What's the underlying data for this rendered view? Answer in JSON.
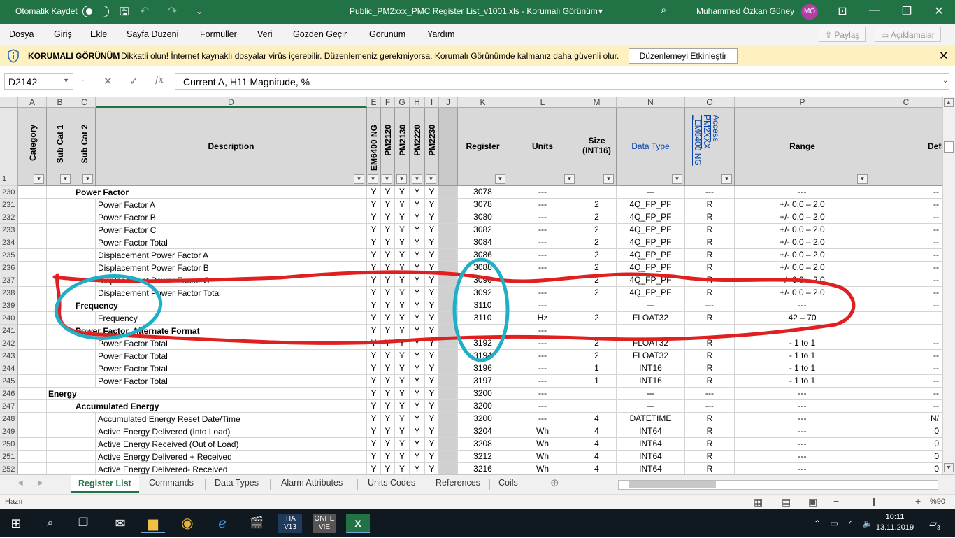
{
  "titlebar": {
    "autosave": "Otomatik Kaydet",
    "title": "Public_PM2xxx_PMC Register List_v1001.xls  -  Korumalı Görünüm",
    "title_caret": "▾",
    "user": "Muhammed Özkan Güney",
    "initials": "MÖ"
  },
  "menu": {
    "items": [
      "Dosya",
      "Giriş",
      "Ekle",
      "Sayfa Düzeni",
      "Formüller",
      "Veri",
      "Gözden Geçir",
      "Görünüm",
      "Yardım"
    ],
    "share": "Paylaş",
    "comments": "Açıklamalar"
  },
  "protected": {
    "title": "KORUMALI GÖRÜNÜM",
    "message": "Dikkatli olun! İnternet kaynaklı dosyalar virüs içerebilir. Düzenlemeniz gerekmiyorsa, Korumalı Görünümde kalmanız daha güvenli olur.",
    "button": "Düzenlemeyi Etkinleştir"
  },
  "formula": {
    "namebox": "D2142",
    "content": "Current A, H11 Magnitude, %",
    "fx": "fx"
  },
  "columns": [
    "A",
    "B",
    "C",
    "D",
    "E",
    "F",
    "G",
    "H",
    "I",
    "J",
    "K",
    "L",
    "M",
    "N",
    "O",
    "P",
    "Q"
  ],
  "headers": {
    "category": "Category",
    "subcat1": "Sub Cat 1",
    "subcat2": "Sub Cat 2",
    "description": "Description",
    "em6400": "EM6400 NG",
    "pm2120": "PM2120",
    "pm2130": "PM2130",
    "pm2220": "PM2220",
    "pm2230": "PM2230",
    "register": "Register",
    "units": "Units",
    "size": "Size (INT16)",
    "datatype": "Data Type",
    "access": "Access PM2XXX _EM6400 NG",
    "range": "Range",
    "default": "Defa",
    "rownum": "1"
  },
  "rows": [
    {
      "n": "230",
      "lvl": "c",
      "desc": "Power Factor",
      "flags": [
        "Y",
        "Y",
        "Y",
        "Y",
        "Y"
      ],
      "reg": "3078",
      "units": "---",
      "size": "",
      "dtype": "---",
      "access": "---",
      "range": "---",
      "def": "--"
    },
    {
      "n": "231",
      "lvl": "d",
      "desc": "Power Factor A",
      "flags": [
        "Y",
        "Y",
        "Y",
        "Y",
        "Y"
      ],
      "reg": "3078",
      "units": "---",
      "size": "2",
      "dtype": "4Q_FP_PF",
      "access": "R",
      "range": "+/- 0.0 – 2.0",
      "def": "--"
    },
    {
      "n": "232",
      "lvl": "d",
      "desc": "Power Factor B",
      "flags": [
        "Y",
        "Y",
        "Y",
        "Y",
        "Y"
      ],
      "reg": "3080",
      "units": "---",
      "size": "2",
      "dtype": "4Q_FP_PF",
      "access": "R",
      "range": "+/- 0.0 – 2.0",
      "def": "--"
    },
    {
      "n": "233",
      "lvl": "d",
      "desc": "Power Factor C",
      "flags": [
        "Y",
        "Y",
        "Y",
        "Y",
        "Y"
      ],
      "reg": "3082",
      "units": "---",
      "size": "2",
      "dtype": "4Q_FP_PF",
      "access": "R",
      "range": "+/- 0.0 – 2.0",
      "def": "--"
    },
    {
      "n": "234",
      "lvl": "d",
      "desc": "Power Factor Total",
      "flags": [
        "Y",
        "Y",
        "Y",
        "Y",
        "Y"
      ],
      "reg": "3084",
      "units": "---",
      "size": "2",
      "dtype": "4Q_FP_PF",
      "access": "R",
      "range": "+/- 0.0 – 2.0",
      "def": "--"
    },
    {
      "n": "235",
      "lvl": "d",
      "desc": "Displacement Power Factor A",
      "flags": [
        "Y",
        "Y",
        "Y",
        "Y",
        "Y"
      ],
      "reg": "3086",
      "units": "---",
      "size": "2",
      "dtype": "4Q_FP_PF",
      "access": "R",
      "range": "+/- 0.0 – 2.0",
      "def": "--"
    },
    {
      "n": "236",
      "lvl": "d",
      "desc": "Displacement Power Factor B",
      "flags": [
        "Y",
        "Y",
        "Y",
        "Y",
        "Y"
      ],
      "reg": "3088",
      "units": "---",
      "size": "2",
      "dtype": "4Q_FP_PF",
      "access": "R",
      "range": "+/- 0.0 – 2.0",
      "def": "--"
    },
    {
      "n": "237",
      "lvl": "d",
      "desc": "Displacement Power Factor C",
      "flags": [
        "Y",
        "Y",
        "Y",
        "Y",
        "Y"
      ],
      "reg": "3090",
      "units": "---",
      "size": "2",
      "dtype": "4Q_FP_PF",
      "access": "R",
      "range": "+/- 0.0 – 2.0",
      "def": "--"
    },
    {
      "n": "238",
      "lvl": "d",
      "desc": "Displacement Power Factor Total",
      "flags": [
        "Y",
        "Y",
        "Y",
        "Y",
        "Y"
      ],
      "reg": "3092",
      "units": "---",
      "size": "2",
      "dtype": "4Q_FP_PF",
      "access": "R",
      "range": "+/- 0.0 – 2.0",
      "def": "--"
    },
    {
      "n": "239",
      "lvl": "c",
      "desc": "Frequency",
      "flags": [
        "Y",
        "Y",
        "Y",
        "Y",
        "Y"
      ],
      "reg": "3110",
      "units": "---",
      "size": "",
      "dtype": "---",
      "access": "---",
      "range": "---",
      "def": "--"
    },
    {
      "n": "240",
      "lvl": "d",
      "desc": "Frequency",
      "flags": [
        "Y",
        "Y",
        "Y",
        "Y",
        "Y"
      ],
      "reg": "3110",
      "units": "Hz",
      "size": "2",
      "dtype": "FLOAT32",
      "access": "R",
      "range": "42 – 70",
      "def": ""
    },
    {
      "n": "241",
      "lvl": "c",
      "desc": "Power Factor, Alternate Format",
      "flags": [
        "Y",
        "Y",
        "Y",
        "Y",
        "Y"
      ],
      "reg": "",
      "units": "---",
      "size": "",
      "dtype": "",
      "access": "",
      "range": "",
      "def": ""
    },
    {
      "n": "242",
      "lvl": "d",
      "desc": "Power Factor Total",
      "flags": [
        "Y",
        "Y",
        "Y",
        "Y",
        "Y"
      ],
      "reg": "3192",
      "units": "---",
      "size": "2",
      "dtype": "FLOAT32",
      "access": "R",
      "range": "- 1 to 1",
      "def": "--"
    },
    {
      "n": "243",
      "lvl": "d",
      "desc": "Power Factor Total",
      "flags": [
        "Y",
        "Y",
        "Y",
        "Y",
        "Y"
      ],
      "reg": "3194",
      "units": "---",
      "size": "2",
      "dtype": "FLOAT32",
      "access": "R",
      "range": "- 1 to 1",
      "def": "--"
    },
    {
      "n": "244",
      "lvl": "d",
      "desc": "Power Factor Total",
      "flags": [
        "Y",
        "Y",
        "Y",
        "Y",
        "Y"
      ],
      "reg": "3196",
      "units": "---",
      "size": "1",
      "dtype": "INT16",
      "access": "R",
      "range": "- 1 to 1",
      "def": "--"
    },
    {
      "n": "245",
      "lvl": "d",
      "desc": "Power Factor Total",
      "flags": [
        "Y",
        "Y",
        "Y",
        "Y",
        "Y"
      ],
      "reg": "3197",
      "units": "---",
      "size": "1",
      "dtype": "INT16",
      "access": "R",
      "range": "- 1 to 1",
      "def": "--"
    },
    {
      "n": "246",
      "lvl": "b",
      "desc": "Energy",
      "flags": [
        "Y",
        "Y",
        "Y",
        "Y",
        "Y"
      ],
      "reg": "3200",
      "units": "---",
      "size": "",
      "dtype": "---",
      "access": "---",
      "range": "---",
      "def": "--"
    },
    {
      "n": "247",
      "lvl": "c",
      "desc": "Accumulated Energy",
      "flags": [
        "Y",
        "Y",
        "Y",
        "Y",
        "Y"
      ],
      "reg": "3200",
      "units": "---",
      "size": "",
      "dtype": "---",
      "access": "---",
      "range": "---",
      "def": "--"
    },
    {
      "n": "248",
      "lvl": "d",
      "desc": "Accumulated Energy Reset Date/Time",
      "flags": [
        "Y",
        "Y",
        "Y",
        "Y",
        "Y"
      ],
      "reg": "3200",
      "units": "---",
      "size": "4",
      "dtype": "DATETIME",
      "access": "R",
      "range": "---",
      "def": "N/"
    },
    {
      "n": "249",
      "lvl": "d",
      "desc": "Active Energy Delivered (Into Load)",
      "flags": [
        "Y",
        "Y",
        "Y",
        "Y",
        "Y"
      ],
      "reg": "3204",
      "units": "Wh",
      "size": "4",
      "dtype": "INT64",
      "access": "R",
      "range": "---",
      "def": "0"
    },
    {
      "n": "250",
      "lvl": "d",
      "desc": "Active Energy Received (Out of Load)",
      "flags": [
        "Y",
        "Y",
        "Y",
        "Y",
        "Y"
      ],
      "reg": "3208",
      "units": "Wh",
      "size": "4",
      "dtype": "INT64",
      "access": "R",
      "range": "---",
      "def": "0"
    },
    {
      "n": "251",
      "lvl": "d",
      "desc": "Active Energy Delivered + Received",
      "flags": [
        "Y",
        "Y",
        "Y",
        "Y",
        "Y"
      ],
      "reg": "3212",
      "units": "Wh",
      "size": "4",
      "dtype": "INT64",
      "access": "R",
      "range": "---",
      "def": "0"
    },
    {
      "n": "252",
      "lvl": "d",
      "desc": "Active Energy Delivered- Received",
      "flags": [
        "Y",
        "Y",
        "Y",
        "Y",
        "Y"
      ],
      "reg": "3216",
      "units": "Wh",
      "size": "4",
      "dtype": "INT64",
      "access": "R",
      "range": "---",
      "def": "0"
    }
  ],
  "tabs": [
    "Register List",
    "Commands",
    "Data Types",
    "Alarm Attributes",
    "Units Codes",
    "References",
    "Coils"
  ],
  "status": {
    "ready": "Hazır",
    "zoom": "%90"
  },
  "taskbar": {
    "tia": "TIA V13",
    "onhe": "ONHE VIE",
    "time": "10:11",
    "date": "13.11.2019",
    "notif": "3"
  },
  "annotation_colors": {
    "red": "#e02020",
    "cyan": "#1fb0c8"
  }
}
